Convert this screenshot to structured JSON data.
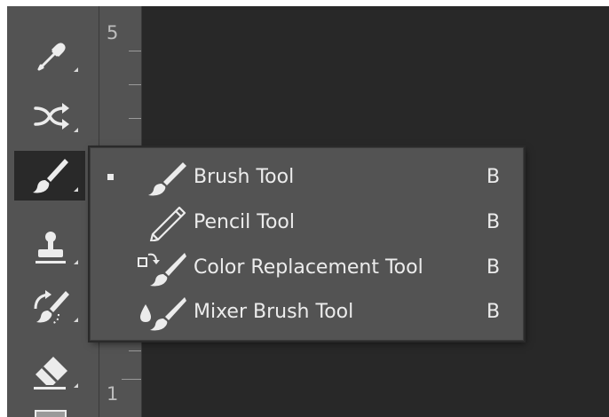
{
  "toolbar": {
    "tools": [
      {
        "name": "eyedropper-tool",
        "icon": "eyedropper-icon",
        "selected": false
      },
      {
        "name": "content-aware-move-tool",
        "icon": "content-aware-move-icon",
        "selected": false
      },
      {
        "name": "brush-tool",
        "icon": "brush-icon",
        "selected": true
      },
      {
        "name": "clone-stamp-tool",
        "icon": "stamp-icon",
        "selected": false
      },
      {
        "name": "history-brush-tool",
        "icon": "history-brush-icon",
        "selected": false
      },
      {
        "name": "eraser-tool",
        "icon": "eraser-icon",
        "selected": false
      },
      {
        "name": "gradient-tool",
        "icon": "gradient-icon",
        "selected": false
      }
    ]
  },
  "ruler": {
    "labels": [
      "5",
      "1"
    ]
  },
  "flyout": {
    "items": [
      {
        "label": "Brush Tool",
        "shortcut": "B",
        "icon": "brush-icon",
        "active": true
      },
      {
        "label": "Pencil Tool",
        "shortcut": "B",
        "icon": "pencil-icon",
        "active": false
      },
      {
        "label": "Color Replacement Tool",
        "shortcut": "B",
        "icon": "color-replacement-icon",
        "active": false
      },
      {
        "label": "Mixer Brush Tool",
        "shortcut": "B",
        "icon": "mixer-brush-icon",
        "active": false
      }
    ]
  },
  "colors": {
    "panel": "#535353",
    "canvas": "#282828",
    "selected_tool_bg": "#292929",
    "text": "#ececec"
  }
}
